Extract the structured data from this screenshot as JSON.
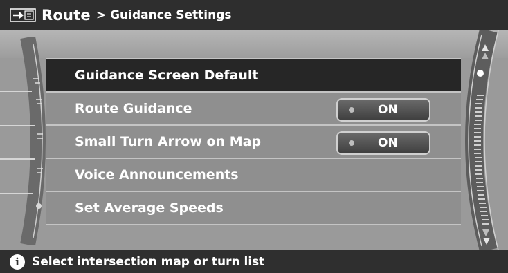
{
  "header": {
    "icon": "route-arrow-icon",
    "title": "Route",
    "separator": ">",
    "subtitle": "Guidance Settings"
  },
  "menu": {
    "items": [
      {
        "label": "Guidance Screen Default",
        "selected": true
      },
      {
        "label": "Route Guidance",
        "toggle": "ON"
      },
      {
        "label": "Small Turn Arrow on Map",
        "toggle": "ON"
      },
      {
        "label": "Voice Announcements"
      },
      {
        "label": "Set Average Speeds"
      }
    ]
  },
  "scrollbar": {
    "up_icon": "scroll-up-icon",
    "down_icon": "scroll-down-icon",
    "position_indicator": "scroll-position-dot-icon"
  },
  "footer": {
    "icon": "info-icon",
    "info_glyph": "i",
    "text": "Select intersection map or turn list"
  },
  "colors": {
    "header_bg": "#2e2e2e",
    "panel_bg": "#9a9a9a",
    "selected_row_bg": "#262626",
    "text": "#ffffff"
  }
}
